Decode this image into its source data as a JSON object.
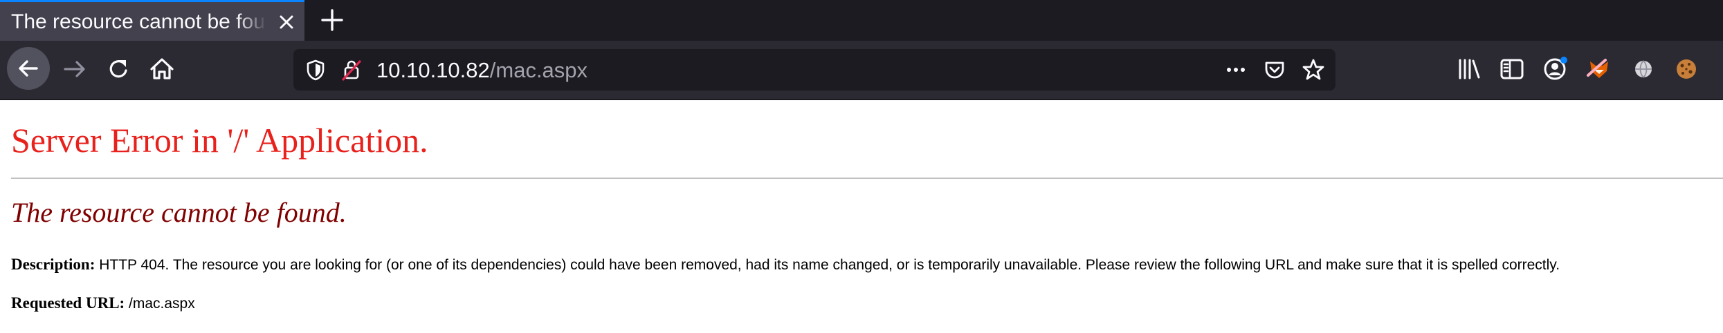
{
  "browser": {
    "tab": {
      "title": "The resource cannot be found."
    },
    "toolbar": {
      "url_host": "10.10.10.82",
      "url_path": "/mac.aspx"
    },
    "colors": {
      "accent": "#0a84ff",
      "toolbar_bg": "#2b2a33",
      "tabstrip_bg": "#1c1b22",
      "urlbar_bg": "#1c1b22"
    },
    "icons": {
      "tab_close": "close-icon",
      "new_tab": "plus-icon",
      "back": "arrow-left-icon",
      "forward": "arrow-right-icon",
      "reload": "reload-icon",
      "home": "home-icon",
      "tracking": "shield-icon",
      "insecure": "lock-strikethrough-icon",
      "page_actions": "more-horizontal-icon",
      "pocket": "pocket-icon",
      "bookmark": "star-icon",
      "library": "library-icon",
      "sidebar": "sidebar-icon",
      "account": "account-icon",
      "extensions": [
        "fox-extension-icon",
        "globe-extension-icon",
        "cookie-extension-icon"
      ]
    }
  },
  "page": {
    "heading": "Server Error in '/' Application.",
    "subheading": "The resource cannot be found.",
    "description_label": "Description:",
    "description_text": " HTTP 404. The resource you are looking for (or one of its dependencies) could have been removed, had its name changed, or is temporarily unavailable.  Please review the following URL and make sure that it is spelled correctly.",
    "requested_url_label": "Requested URL:",
    "requested_url_value": " /mac.aspx",
    "colors": {
      "heading": "#e8211c",
      "subheading": "#800000"
    }
  }
}
